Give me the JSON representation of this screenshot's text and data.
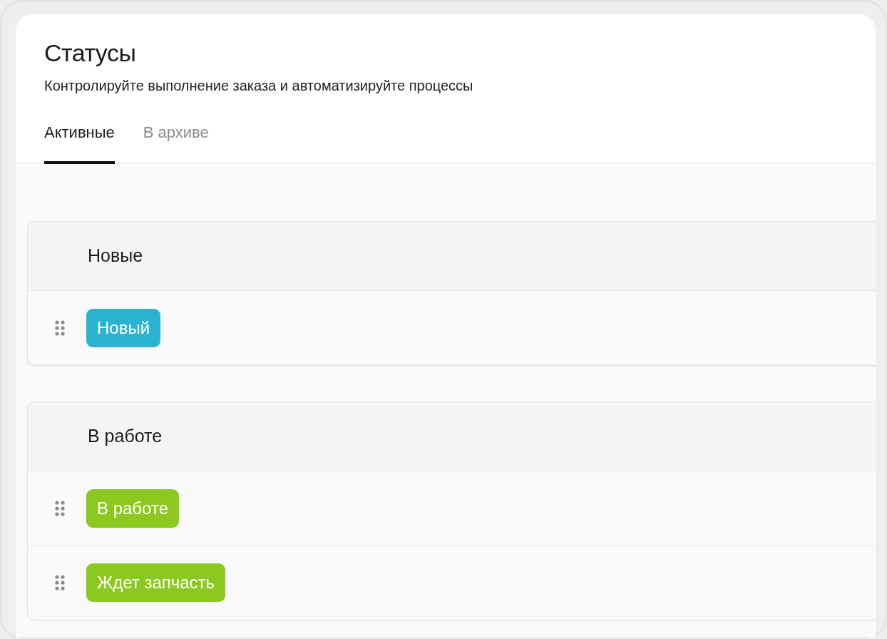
{
  "header": {
    "title": "Статусы",
    "subtitle": "Контролируйте выполнение заказа и автоматизируйте процессы"
  },
  "tabs": [
    {
      "label": "Активные",
      "selected": true
    },
    {
      "label": "В архиве",
      "selected": false
    }
  ],
  "groups": [
    {
      "title": "Новые",
      "statuses": [
        {
          "label": "Новый",
          "color": "#2bb3d1"
        }
      ]
    },
    {
      "title": "В работе",
      "statuses": [
        {
          "label": "В работе",
          "color": "#8cc920"
        },
        {
          "label": "Ждет запчасть",
          "color": "#8cc920"
        }
      ]
    }
  ]
}
